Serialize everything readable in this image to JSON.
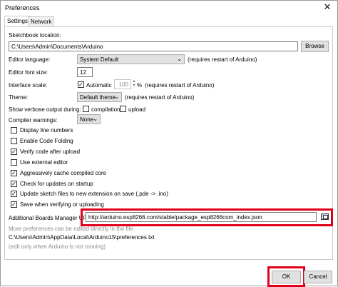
{
  "window": {
    "title": "Preferences",
    "close_glyph": "✕"
  },
  "tabs": [
    {
      "label": "Settings"
    },
    {
      "label": "Network"
    }
  ],
  "settings": {
    "sketchbook_label": "Sketchbook location:",
    "sketchbook_value": "C:\\Users\\Admin\\Documents\\Arduino",
    "browse_label": "Browse",
    "editor_language_label": "Editor language:",
    "editor_language_value": "System Default",
    "editor_language_note": "(requires restart of Arduino)",
    "font_size_label": "Editor font size:",
    "font_size_value": "12",
    "interface_scale_label": "Interface scale:",
    "automatic_label": "Automatic",
    "scale_value": "100",
    "scale_unit": "%",
    "scale_note": "(requires restart of Arduino)",
    "theme_label": "Theme:",
    "theme_value": "Default theme",
    "theme_note": "(requires restart of Arduino)",
    "verbose_label": "Show verbose output during:",
    "compilation_label": "compilation",
    "upload_label": "upload",
    "compiler_warnings_label": "Compiler warnings:",
    "compiler_warnings_value": "None",
    "checkboxes": [
      {
        "label": "Display line numbers",
        "checked": false
      },
      {
        "label": "Enable Code Folding",
        "checked": false
      },
      {
        "label": "Verify code after upload",
        "checked": true
      },
      {
        "label": "Use external editor",
        "checked": false
      },
      {
        "label": "Aggressively cache compiled core",
        "checked": true
      },
      {
        "label": "Check for updates on startup",
        "checked": true
      },
      {
        "label": "Update sketch files to new extension on save (.pde -> .ino)",
        "checked": true
      },
      {
        "label": "Save when verifying or uploading",
        "checked": true
      }
    ],
    "boards_url_label": "Additional Boards Manager URLs:",
    "boards_url_value": "http://arduino.esp8266.com/stable/package_esp8266com_index.json",
    "more_prefs_note": "More preferences can be edited directly in the file",
    "prefs_path": "C:\\Users\\Admin\\AppData\\Local\\Arduino15\\preferences.txt",
    "edit_note": "(edit only when Arduino is not running)"
  },
  "footer": {
    "ok_label": "OK",
    "cancel_label": "Cancel"
  },
  "check_glyph": "✓",
  "colors": {
    "highlight": "#e0001b"
  }
}
